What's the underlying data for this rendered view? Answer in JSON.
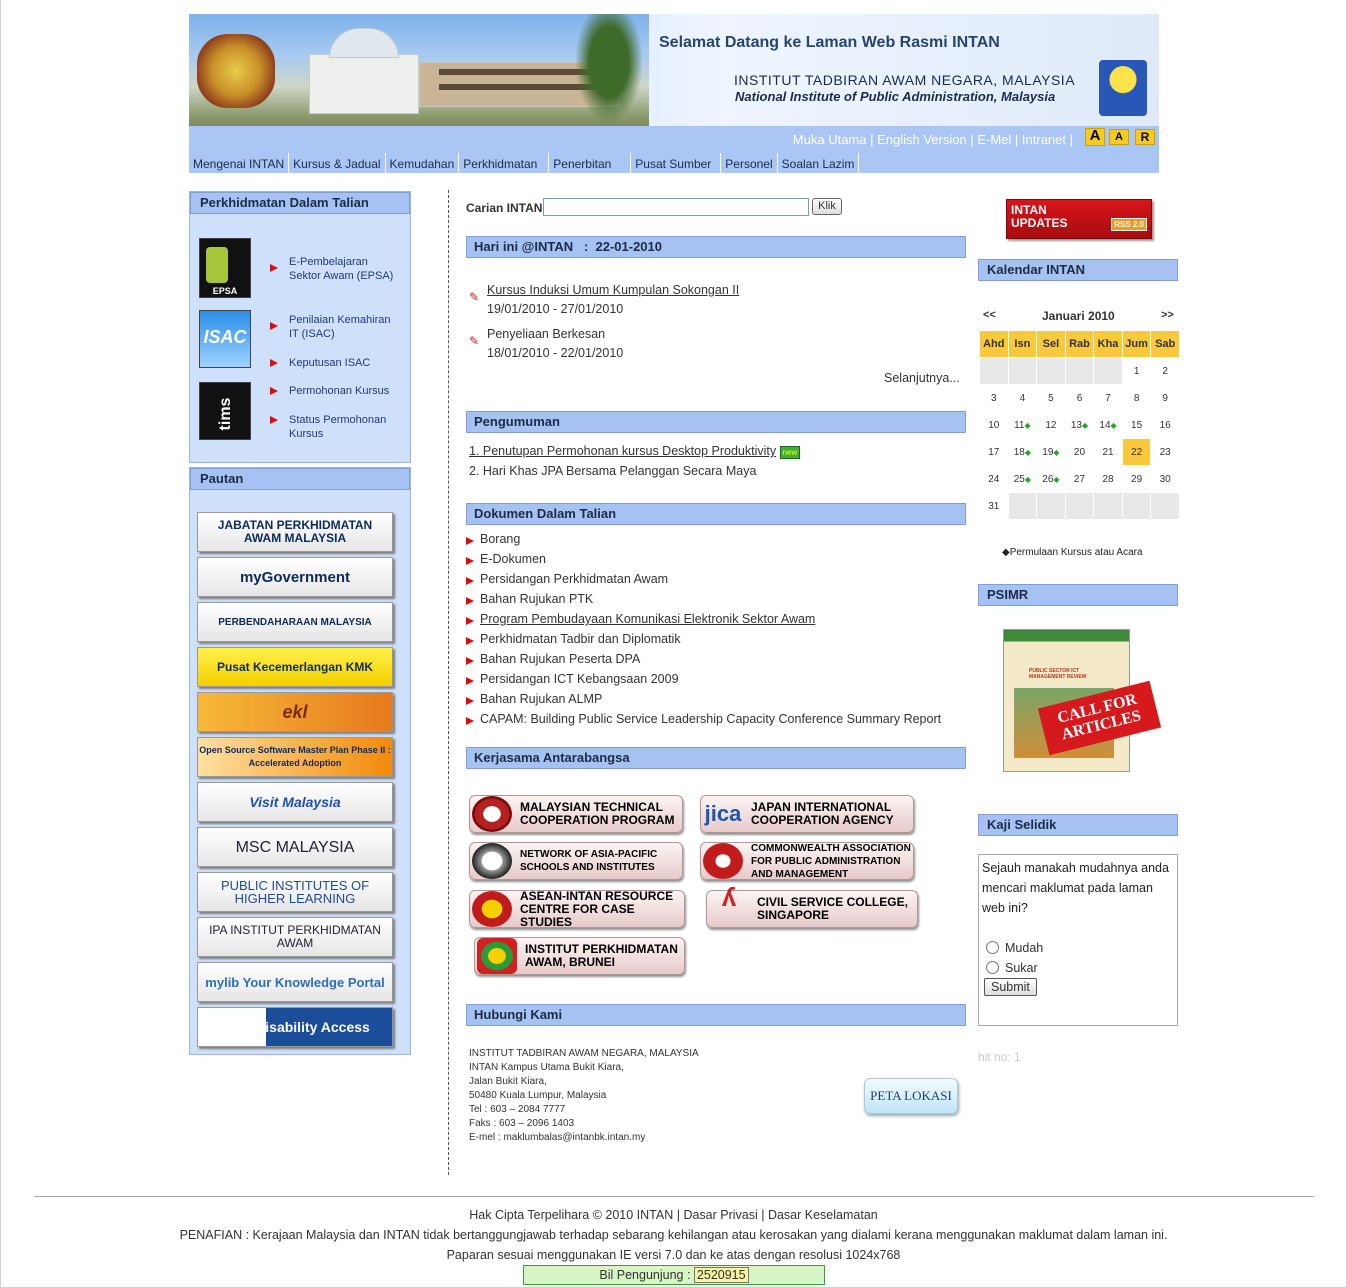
{
  "header": {
    "welcome": "Selamat Datang ke Laman Web Rasmi INTAN",
    "org_malay": "INSTITUT TADBIRAN AWAM NEGARA, MALAYSIA",
    "org_english": "National Institute of Public Administration, Malaysia",
    "top_links": [
      "Muka Utama",
      "English Version",
      "E-Mel",
      "Intranet"
    ],
    "font_buttons": [
      "A",
      "A",
      "R"
    ]
  },
  "nav": [
    "Mengenai INTAN",
    "Kursus & Jadual",
    "Kemudahan",
    "Perkhidmatan",
    "Penerbitan",
    "Pusat Sumber",
    "Personel",
    "Soalan Lazim"
  ],
  "left": {
    "services_title": "Perkhidmatan Dalam Talian",
    "services": [
      "E-Pembelajaran Sektor Awam (EPSA)",
      "Penilaian Kemahiran IT (ISAC)",
      "Keputusan ISAC",
      "Permohonan Kursus",
      "Status Permohonan Kursus"
    ],
    "service_icons": [
      "EPSA",
      "ISAC",
      "tims"
    ],
    "links_title": "Pautan",
    "links": [
      "JABATAN PERKHIDMATAN AWAM MALAYSIA",
      "myGovernment",
      "PERBENDAHARAAN MALAYSIA",
      "Pusat Kecemerlangan KMK",
      "ekl",
      "Open Source Software Master Plan Phase II : Accelerated Adoption",
      "Visit Malaysia",
      "MSC MALAYSIA",
      "PUBLIC INSTITUTES OF HIGHER LEARNING",
      "IPA INSTITUT PERKHIDMATAN AWAM",
      "mylib Your Knowledge Portal",
      "W3C Disability Access"
    ]
  },
  "center": {
    "search_label": "Carian INTAN",
    "search_button": "Klik",
    "today_title": "Hari ini @INTAN   :  22-01-2010",
    "today": [
      {
        "title": "Kursus Induksi Umum Kumpulan Sokongan II",
        "dates": "19/01/2010 - 27/01/2010"
      },
      {
        "title": "Penyeliaan Berkesan",
        "dates": "18/01/2010 - 22/01/2010"
      }
    ],
    "more": "Selanjutnya...",
    "announce_title": "Pengumuman",
    "announcements": [
      "1. Penutupan Permohonan kursus Desktop Produktivity",
      "2. Hari Khas JPA Bersama Pelanggan Secara Maya"
    ],
    "new_badge": "new",
    "docs_title": "Dokumen Dalam Talian",
    "docs": [
      "Borang",
      "E-Dokumen",
      "Persidangan Perkhidmatan Awam",
      "Bahan Rujukan PTK",
      "Program Pembudayaan Komunikasi Elektronik Sektor Awam",
      "Perkhidmatan Tadbir dan Diplomatik",
      "Bahan Rujukan Peserta DPA",
      "Persidangan ICT Kebangsaan 2009",
      "Bahan Rujukan ALMP",
      "CAPAM: Building Public Service Leadership Capacity Conference Summary Report"
    ],
    "intl_title": "Kerjasama Antarabangsa",
    "intl": [
      "MALAYSIAN TECHNICAL COOPERATION PROGRAM",
      "JAPAN INTERNATIONAL COOPERATION AGENCY",
      "NETWORK OF ASIA-PACIFIC SCHOOLS AND INSTITUTES",
      "COMMONWEALTH ASSOCIATION FOR PUBLIC ADMINISTRATION AND MANAGEMENT",
      "ASEAN-INTAN RESOURCE CENTRE FOR CASE STUDIES",
      "CIVIL SERVICE COLLEGE, SINGAPORE",
      "INSTITUT PERKHIDMATAN AWAM, BRUNEI"
    ],
    "contact_title": "Hubungi Kami",
    "contact": [
      "INSTITUT TADBIRAN AWAM NEGARA, MALAYSIA",
      "INTAN Kampus Utama Bukit Kiara,",
      "Jalan Bukit Kiara,",
      "50480 Kuala Lumpur, Malaysia",
      "Tel : 603 – 2084 7777",
      "Faks : 603 – 2096 1403",
      "E-mel : maklumbalas@intanbk.intan.my"
    ],
    "map_button": "PETA LOKASI"
  },
  "right": {
    "updates": "INTAN UPDATES",
    "rss": "RSS 2.0",
    "calendar_title": "Kalendar INTAN",
    "prev": "<<",
    "next": ">>",
    "month": "Januari 2010",
    "days": [
      "Ahd",
      "Isn",
      "Sel",
      "Rab",
      "Kha",
      "Jum",
      "Sab"
    ],
    "legend": "◆Permulaan Kursus atau Acara",
    "psimr_title": "PSIMR",
    "psimr_cover": "PUBLIC SECTOR ICT MANAGEMENT REVIEW",
    "call_for_articles": "CALL FOR ARTICLES",
    "survey_title": "Kaji Selidik",
    "survey_question": "Sejauh manakah mudahnya anda mencari maklumat pada laman web ini?",
    "options": [
      "Mudah",
      "Sukar"
    ],
    "submit": "Submit",
    "hit": "hit no: 1"
  },
  "footer": {
    "copyright": "Hak Cipta Terpelihara © 2010 INTAN |  Dasar Privasi | Dasar Keselamatan",
    "disclaimer": "PENAFIAN : Kerajaan Malaysia dan INTAN tidak bertanggungjawab terhadap sebarang kehilangan atau kerosakan yang dialami kerana menggunakan maklumat dalam laman ini.",
    "resolution": "Paparan sesuai menggunakan IE versi 7.0 dan ke atas dengan resolusi 1024x768",
    "visitors_label": "Bil Pengunjung :",
    "visitors": "2520915"
  }
}
